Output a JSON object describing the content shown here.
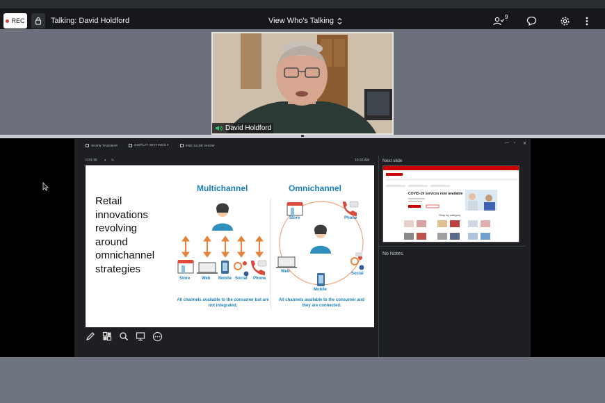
{
  "topbar": {
    "rec_label": "REC",
    "talking": "Talking: David Holdford",
    "view_mode": "View Who's Talking",
    "participants_count": "9",
    "icons": [
      "lock-icon",
      "participants-icon",
      "chat-icon",
      "settings-icon",
      "more-icon"
    ]
  },
  "video": {
    "name": "David Holdford",
    "speaker_icon": "audio-icon"
  },
  "presenter": {
    "toolbar": {
      "show_taskbar": "SHOW TASKBAR",
      "display_settings": "DISPLAY SETTINGS ▾",
      "end_show": "END SLIDE SHOW"
    },
    "timer": "0:31:35",
    "clock": "10:33 AM",
    "next_slide_label": "Next slide",
    "notes": "No Notes."
  },
  "slide": {
    "body_text": "Retail innovations revolving around omnichannel strategies",
    "multichannel_title": "Multichannel",
    "omnichannel_title": "Omnichannel",
    "multi_labels": [
      "Store",
      "Web",
      "Mobile",
      "Social",
      "Phone"
    ],
    "omni_labels": [
      "Store",
      "Phone",
      "Web",
      "Social",
      "Mobile"
    ],
    "multi_caption": "All channels available to the consumer but are not integrated.",
    "omni_caption": "All channels available to the consumer and they are connected."
  },
  "next_slide_thumb": {
    "heading": "COVID-19 services now available",
    "category": "Shop by category"
  },
  "colors": {
    "accent_blue": "#1a7fb8",
    "arrow_orange": "#e8823a",
    "brand_red": "#cc0000"
  }
}
